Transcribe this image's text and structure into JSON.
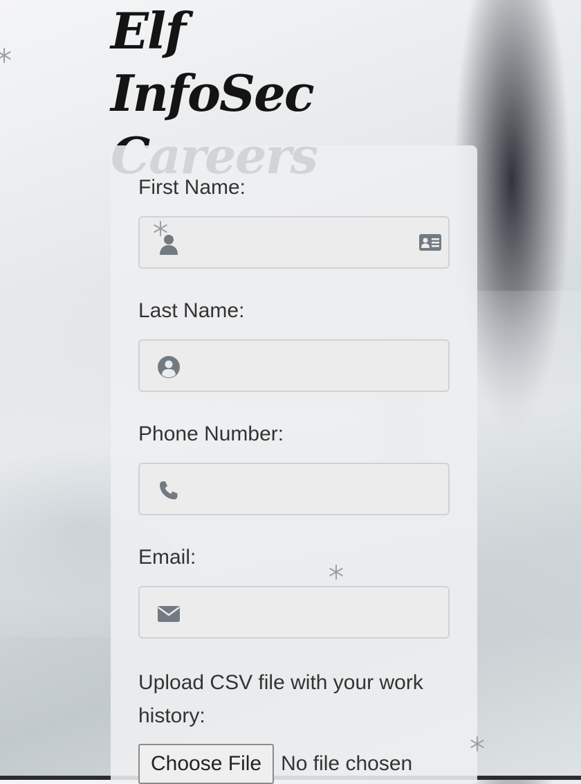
{
  "page": {
    "title_line1": "Elf InfoSec",
    "title_line2": "Careers"
  },
  "form": {
    "first_name_label": "First Name:",
    "last_name_label": "Last Name:",
    "phone_label": "Phone Number:",
    "email_label": "Email:",
    "upload_label": "Upload CSV file with your work history:",
    "choose_file_label": "Choose File",
    "file_status": "No file chosen",
    "first_name_value": "",
    "last_name_value": "",
    "phone_value": "",
    "email_value": ""
  },
  "icons": {
    "first_name_left": "user-icon",
    "first_name_right": "address-card-icon",
    "last_name": "user-circle-icon",
    "phone": "phone-icon",
    "email": "envelope-icon",
    "decoration": "snowflake-icon"
  },
  "colors": {
    "icon": "#727a82",
    "panel": "#eeeff0",
    "text": "#333333",
    "title": "#141414"
  }
}
